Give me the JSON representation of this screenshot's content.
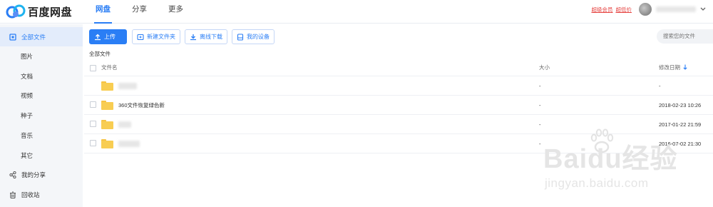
{
  "app": {
    "logo_text": "百度网盘",
    "brand_color": "#2a7ef5"
  },
  "topnav": {
    "tabs": [
      {
        "label": "网盘",
        "active": true
      },
      {
        "label": "分享",
        "active": false
      },
      {
        "label": "更多",
        "active": false
      }
    ]
  },
  "user": {
    "vip_link1": "超级会员",
    "vip_link2": "超低价",
    "dropdown_icon": "chevron-down-icon"
  },
  "sidebar": {
    "items": [
      {
        "label": "全部文件",
        "icon": "file-icon",
        "active": true
      },
      {
        "label": "图片"
      },
      {
        "label": "文档"
      },
      {
        "label": "视频"
      },
      {
        "label": "种子"
      },
      {
        "label": "音乐"
      },
      {
        "label": "其它"
      },
      {
        "label": "我的分享",
        "icon": "share-icon"
      },
      {
        "label": "回收站",
        "icon": "trash-icon"
      }
    ]
  },
  "toolbar": {
    "upload": "上传",
    "new_folder": "新建文件夹",
    "offline_download": "离线下载",
    "my_devices": "我的设备",
    "search_placeholder": "搜索您的文件"
  },
  "breadcrumb": "全部文件",
  "table": {
    "headers": {
      "name": "文件名",
      "size": "大小",
      "date": "修改日期"
    },
    "rows": [
      {
        "name": "",
        "size": "-",
        "date": "-"
      },
      {
        "name": "360文件恢复绿色新",
        "size": "-",
        "date": "2018-02-23 10:26"
      },
      {
        "name": "",
        "size": "-",
        "date": "2017-01-22 21:59"
      },
      {
        "name": "",
        "size": "-",
        "date": "2016-07-02 21:30"
      }
    ]
  },
  "watermark": {
    "text": "Baidu经验",
    "url": "jingyan.baidu.com"
  }
}
